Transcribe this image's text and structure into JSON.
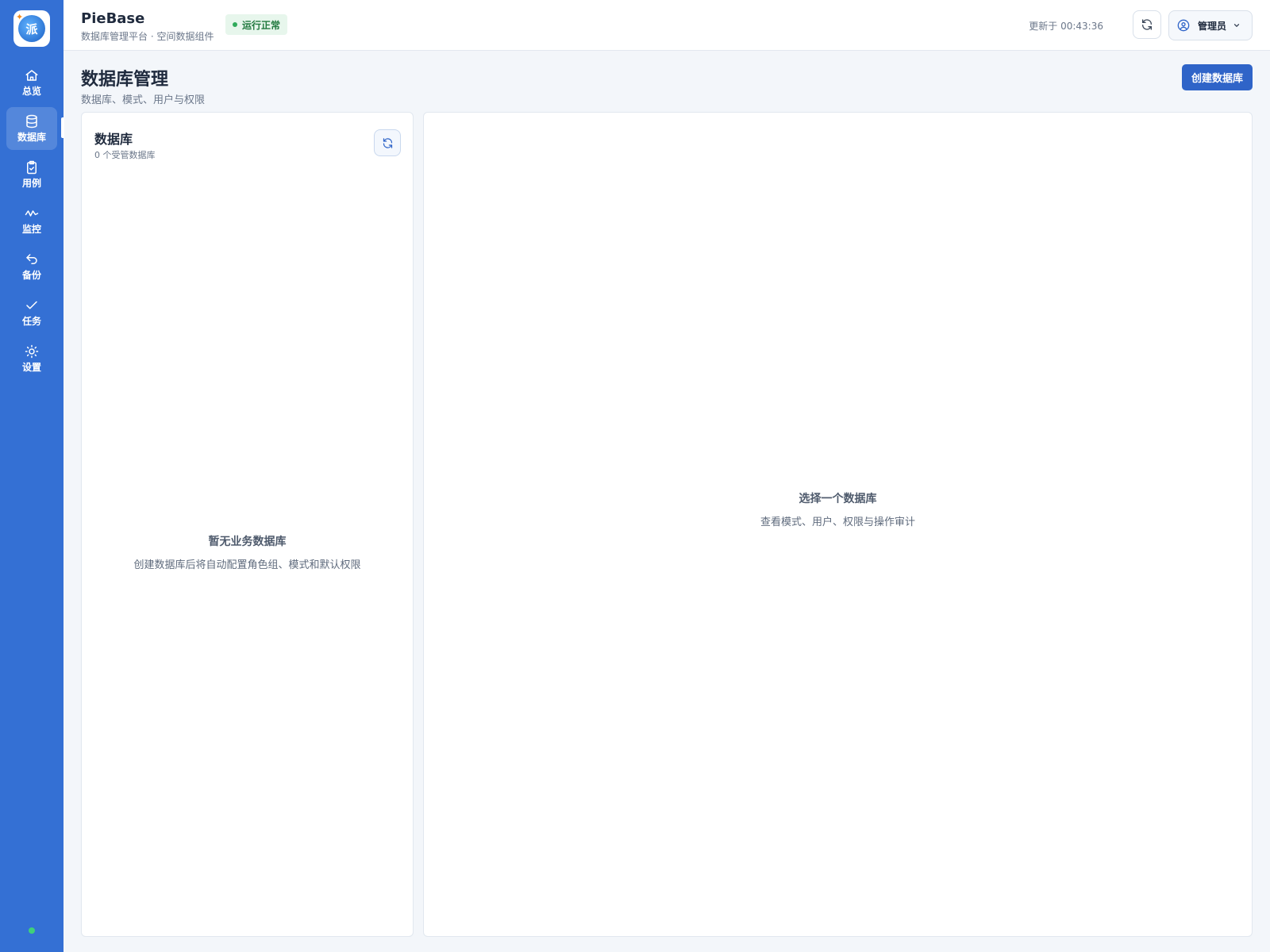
{
  "sidebar": {
    "logo_text": "派",
    "items": [
      {
        "label": "总览",
        "icon": "home-icon"
      },
      {
        "label": "数据库",
        "icon": "database-icon"
      },
      {
        "label": "用例",
        "icon": "clipboard-check-icon"
      },
      {
        "label": "监控",
        "icon": "activity-icon"
      },
      {
        "label": "备份",
        "icon": "undo-icon"
      },
      {
        "label": "任务",
        "icon": "check-icon"
      },
      {
        "label": "设置",
        "icon": "sun-icon"
      }
    ],
    "active_index": 1,
    "status_color": "#3fd07a"
  },
  "header": {
    "title": "PieBase",
    "subtitle": "数据库管理平台 · 空间数据组件",
    "status_badge": "运行正常",
    "updated_text": "更新于 00:43:36",
    "user_label": "管理员"
  },
  "page": {
    "title": "数据库管理",
    "subtitle": "数据库、模式、用户与权限",
    "create_button": "创建数据库"
  },
  "left_panel": {
    "title": "数据库",
    "count_text": "0 个受管数据库",
    "empty_title": "暂无业务数据库",
    "empty_desc": "创建数据库后将自动配置角色组、模式和默认权限"
  },
  "right_panel": {
    "empty_title": "选择一个数据库",
    "empty_desc": "查看模式、用户、权限与操作审计"
  },
  "colors": {
    "sidebar": "#3470d4",
    "primary": "#2f64c8",
    "status_green": "#2faa5a"
  }
}
